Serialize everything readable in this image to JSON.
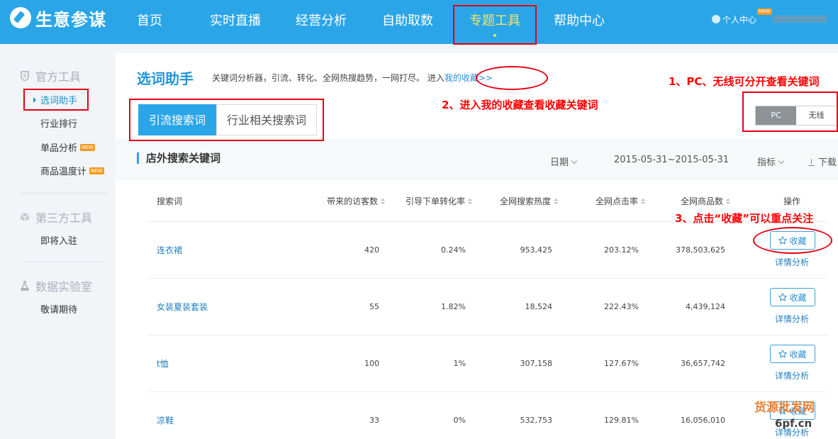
{
  "brand": {
    "name": "生意参谋"
  },
  "nav": {
    "items": [
      {
        "label": "首页",
        "active": false
      },
      {
        "label": "实时直播",
        "active": false
      },
      {
        "label": "经营分析",
        "active": false
      },
      {
        "label": "自助取数",
        "active": false
      },
      {
        "label": "专题工具",
        "active": true
      },
      {
        "label": "帮助中心",
        "active": false
      }
    ],
    "user_center": "个人中心",
    "user_new_tag": "NEW"
  },
  "sidebar": {
    "groups": [
      {
        "title": "官方工具",
        "icon": "shield-icon",
        "items": [
          {
            "label": "选词助手",
            "active": true,
            "new": false
          },
          {
            "label": "行业排行",
            "active": false,
            "new": false
          },
          {
            "label": "单品分析",
            "active": false,
            "new": true
          },
          {
            "label": "商品温度计",
            "active": false,
            "new": true
          }
        ]
      },
      {
        "title": "第三方工具",
        "icon": "cube-icon",
        "items": [
          {
            "label": "即将入驻",
            "active": false,
            "new": false
          }
        ]
      },
      {
        "title": "数据实验室",
        "icon": "flask-icon",
        "items": [
          {
            "label": "敬请期待",
            "active": false,
            "new": false
          }
        ]
      }
    ],
    "new_tag": "NEW"
  },
  "main": {
    "title": "选词助手",
    "desc": "关键词分析器，引流、转化、全网热搜趋势，一网打尽。 进入",
    "fav_link": "我的收藏>>",
    "tabs": [
      {
        "label": "引流搜索词",
        "active": true
      },
      {
        "label": "行业相关搜索词",
        "active": false
      }
    ],
    "device": {
      "pc": "PC",
      "wireless": "无线",
      "selected": "PC"
    },
    "section_title": "店外搜索关键词",
    "filter_date_label": "日期",
    "date_range": "2015-05-31~2015-05-31",
    "filter_metric_label": "指标",
    "download_label": "下载"
  },
  "table": {
    "columns": [
      "搜索词",
      "带来的访客数",
      "引导下单转化率",
      "全网搜索热度",
      "全网点击率",
      "全网商品数",
      "操作"
    ],
    "fav_label": "收藏",
    "detail_label": "详情分析",
    "rows": [
      {
        "keyword": "连衣裙",
        "visitors": "420",
        "conversion": "0.24%",
        "heat": "953,425",
        "ctr": "203.12%",
        "goods": "378,503,625"
      },
      {
        "keyword": "女装夏装套装",
        "visitors": "55",
        "conversion": "1.82%",
        "heat": "18,524",
        "ctr": "222.43%",
        "goods": "4,439,124"
      },
      {
        "keyword": "t恤",
        "visitors": "100",
        "conversion": "1%",
        "heat": "307,158",
        "ctr": "127.67%",
        "goods": "36,657,742"
      },
      {
        "keyword": "凉鞋",
        "visitors": "33",
        "conversion": "0%",
        "heat": "532,753",
        "ctr": "129.81%",
        "goods": "16,056,010"
      }
    ]
  },
  "annotations": {
    "a1": "1、PC、无线可分开查看关键词",
    "a2": "2、进入我的收藏查看收藏关键词",
    "a3": "3、点击“收藏”可以重点关注"
  },
  "watermark": {
    "line1": "货源批发网",
    "line2": "6pf.cn"
  },
  "colors": {
    "brand_blue": "#2aa6e8",
    "nav_active": "#ffe35a",
    "annotation_red": "#ff0000",
    "new_badge": "#f39a1e"
  }
}
